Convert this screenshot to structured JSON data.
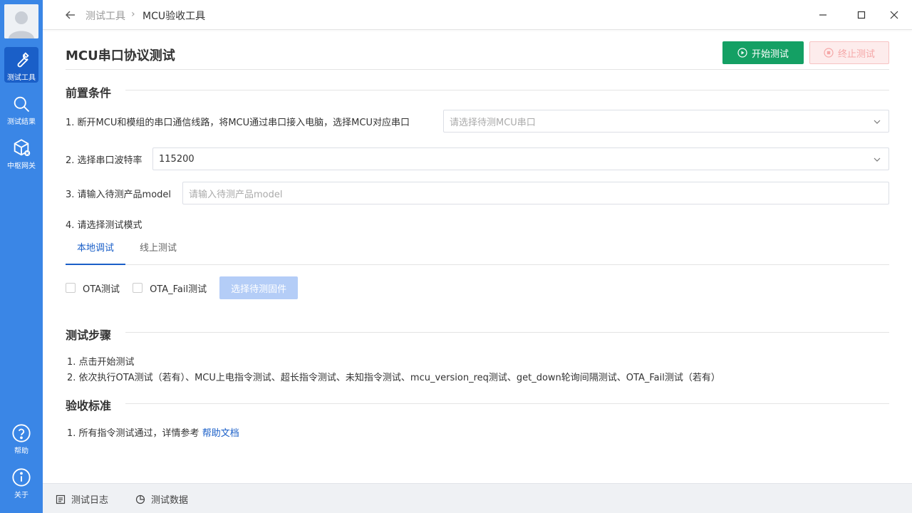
{
  "sidebar": {
    "items": [
      {
        "label": "测试工具",
        "icon": "wrench-icon"
      },
      {
        "label": "测试结果",
        "icon": "search-icon"
      },
      {
        "label": "中枢网关",
        "icon": "cube-icon"
      }
    ],
    "bottom_items": [
      {
        "label": "帮助",
        "icon": "help-icon"
      },
      {
        "label": "关于",
        "icon": "info-icon"
      }
    ]
  },
  "titlebar": {
    "breadcrumb": [
      "测试工具",
      "MCU验收工具"
    ]
  },
  "header": {
    "title": "MCU串口协议测试",
    "start_label": "开始测试",
    "stop_label": "终止测试"
  },
  "preconditions": {
    "title": "前置条件",
    "step1_label": "1. 断开MCU和模组的串口通信线路，将MCU通过串口接入电脑，选择MCU对应串口",
    "step1_placeholder": "请选择待测MCU串口",
    "step2_label": "2. 选择串口波特率",
    "step2_value": "115200",
    "step3_label": "3. 请输入待测产品model",
    "step3_placeholder": "请输入待测产品model",
    "step4_label": "4. 请选择测试模式",
    "tabs": [
      "本地调试",
      "线上测试"
    ],
    "check_ota": "OTA测试",
    "check_ota_fail": "OTA_Fail测试",
    "select_fw_label": "选择待测固件"
  },
  "steps": {
    "title": "测试步骤",
    "items": [
      "1. 点击开始测试",
      "2. 依次执行OTA测试（若有）、MCU上电指令测试、超长指令测试、未知指令测试、mcu_version_req测试、get_down轮询间隔测试、OTA_Fail测试（若有）"
    ]
  },
  "criteria": {
    "title": "验收标准",
    "text": "1. 所有指令测试通过，详情参考",
    "link": "帮助文档"
  },
  "bottombar": {
    "log_label": "测试日志",
    "data_label": "测试数据"
  },
  "colors": {
    "sidebar": "#3a86e6",
    "sidebar_active": "#1a5fc8",
    "start_button": "#14a064",
    "stop_button_bg": "#fdecec",
    "disabled_button": "#b4cdf7",
    "link": "#1a5fc8"
  }
}
